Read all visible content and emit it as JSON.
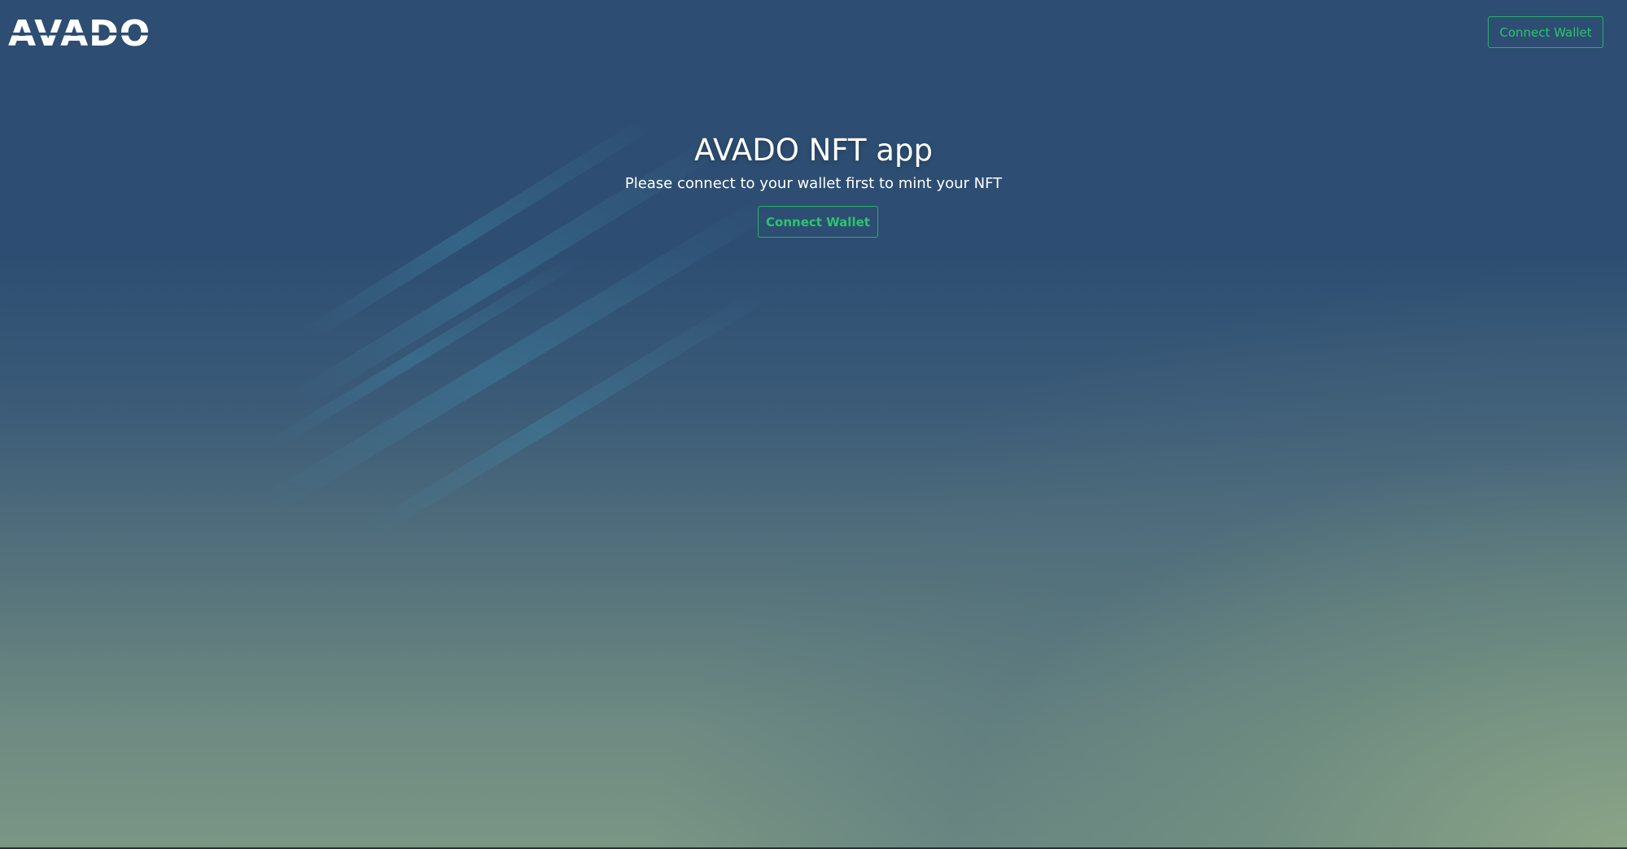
{
  "header": {
    "logo_text": "AVADO",
    "connect_button_label": "Connect Wallet"
  },
  "main": {
    "title": "AVADO NFT app",
    "subtitle": "Please connect to your wallet first to mint your NFT",
    "connect_button_label": "Connect Wallet"
  },
  "colors": {
    "accent_green": "#2bc470",
    "background_top": "#2d4e72",
    "background_bottom": "#7a9684"
  }
}
